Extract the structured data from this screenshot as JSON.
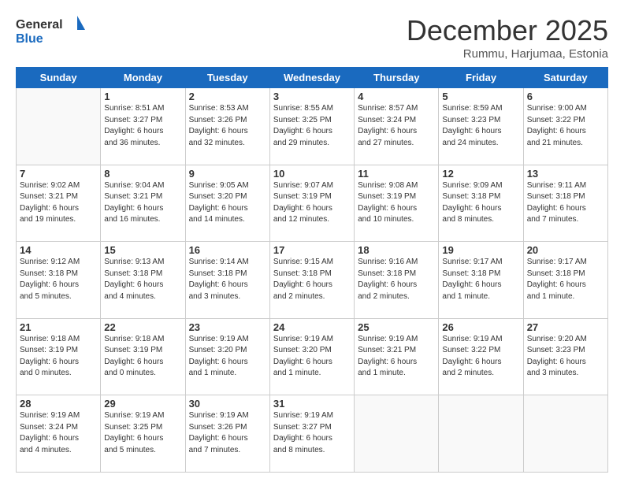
{
  "logo": {
    "line1": "General",
    "line2": "Blue"
  },
  "title": "December 2025",
  "subtitle": "Rummu, Harjumaa, Estonia",
  "weekdays": [
    "Sunday",
    "Monday",
    "Tuesday",
    "Wednesday",
    "Thursday",
    "Friday",
    "Saturday"
  ],
  "weeks": [
    [
      {
        "day": "",
        "info": ""
      },
      {
        "day": "1",
        "info": "Sunrise: 8:51 AM\nSunset: 3:27 PM\nDaylight: 6 hours\nand 36 minutes."
      },
      {
        "day": "2",
        "info": "Sunrise: 8:53 AM\nSunset: 3:26 PM\nDaylight: 6 hours\nand 32 minutes."
      },
      {
        "day": "3",
        "info": "Sunrise: 8:55 AM\nSunset: 3:25 PM\nDaylight: 6 hours\nand 29 minutes."
      },
      {
        "day": "4",
        "info": "Sunrise: 8:57 AM\nSunset: 3:24 PM\nDaylight: 6 hours\nand 27 minutes."
      },
      {
        "day": "5",
        "info": "Sunrise: 8:59 AM\nSunset: 3:23 PM\nDaylight: 6 hours\nand 24 minutes."
      },
      {
        "day": "6",
        "info": "Sunrise: 9:00 AM\nSunset: 3:22 PM\nDaylight: 6 hours\nand 21 minutes."
      }
    ],
    [
      {
        "day": "7",
        "info": "Sunrise: 9:02 AM\nSunset: 3:21 PM\nDaylight: 6 hours\nand 19 minutes."
      },
      {
        "day": "8",
        "info": "Sunrise: 9:04 AM\nSunset: 3:21 PM\nDaylight: 6 hours\nand 16 minutes."
      },
      {
        "day": "9",
        "info": "Sunrise: 9:05 AM\nSunset: 3:20 PM\nDaylight: 6 hours\nand 14 minutes."
      },
      {
        "day": "10",
        "info": "Sunrise: 9:07 AM\nSunset: 3:19 PM\nDaylight: 6 hours\nand 12 minutes."
      },
      {
        "day": "11",
        "info": "Sunrise: 9:08 AM\nSunset: 3:19 PM\nDaylight: 6 hours\nand 10 minutes."
      },
      {
        "day": "12",
        "info": "Sunrise: 9:09 AM\nSunset: 3:18 PM\nDaylight: 6 hours\nand 8 minutes."
      },
      {
        "day": "13",
        "info": "Sunrise: 9:11 AM\nSunset: 3:18 PM\nDaylight: 6 hours\nand 7 minutes."
      }
    ],
    [
      {
        "day": "14",
        "info": "Sunrise: 9:12 AM\nSunset: 3:18 PM\nDaylight: 6 hours\nand 5 minutes."
      },
      {
        "day": "15",
        "info": "Sunrise: 9:13 AM\nSunset: 3:18 PM\nDaylight: 6 hours\nand 4 minutes."
      },
      {
        "day": "16",
        "info": "Sunrise: 9:14 AM\nSunset: 3:18 PM\nDaylight: 6 hours\nand 3 minutes."
      },
      {
        "day": "17",
        "info": "Sunrise: 9:15 AM\nSunset: 3:18 PM\nDaylight: 6 hours\nand 2 minutes."
      },
      {
        "day": "18",
        "info": "Sunrise: 9:16 AM\nSunset: 3:18 PM\nDaylight: 6 hours\nand 2 minutes."
      },
      {
        "day": "19",
        "info": "Sunrise: 9:17 AM\nSunset: 3:18 PM\nDaylight: 6 hours\nand 1 minute."
      },
      {
        "day": "20",
        "info": "Sunrise: 9:17 AM\nSunset: 3:18 PM\nDaylight: 6 hours\nand 1 minute."
      }
    ],
    [
      {
        "day": "21",
        "info": "Sunrise: 9:18 AM\nSunset: 3:19 PM\nDaylight: 6 hours\nand 0 minutes."
      },
      {
        "day": "22",
        "info": "Sunrise: 9:18 AM\nSunset: 3:19 PM\nDaylight: 6 hours\nand 0 minutes."
      },
      {
        "day": "23",
        "info": "Sunrise: 9:19 AM\nSunset: 3:20 PM\nDaylight: 6 hours\nand 1 minute."
      },
      {
        "day": "24",
        "info": "Sunrise: 9:19 AM\nSunset: 3:20 PM\nDaylight: 6 hours\nand 1 minute."
      },
      {
        "day": "25",
        "info": "Sunrise: 9:19 AM\nSunset: 3:21 PM\nDaylight: 6 hours\nand 1 minute."
      },
      {
        "day": "26",
        "info": "Sunrise: 9:19 AM\nSunset: 3:22 PM\nDaylight: 6 hours\nand 2 minutes."
      },
      {
        "day": "27",
        "info": "Sunrise: 9:20 AM\nSunset: 3:23 PM\nDaylight: 6 hours\nand 3 minutes."
      }
    ],
    [
      {
        "day": "28",
        "info": "Sunrise: 9:19 AM\nSunset: 3:24 PM\nDaylight: 6 hours\nand 4 minutes."
      },
      {
        "day": "29",
        "info": "Sunrise: 9:19 AM\nSunset: 3:25 PM\nDaylight: 6 hours\nand 5 minutes."
      },
      {
        "day": "30",
        "info": "Sunrise: 9:19 AM\nSunset: 3:26 PM\nDaylight: 6 hours\nand 7 minutes."
      },
      {
        "day": "31",
        "info": "Sunrise: 9:19 AM\nSunset: 3:27 PM\nDaylight: 6 hours\nand 8 minutes."
      },
      {
        "day": "",
        "info": ""
      },
      {
        "day": "",
        "info": ""
      },
      {
        "day": "",
        "info": ""
      }
    ]
  ]
}
